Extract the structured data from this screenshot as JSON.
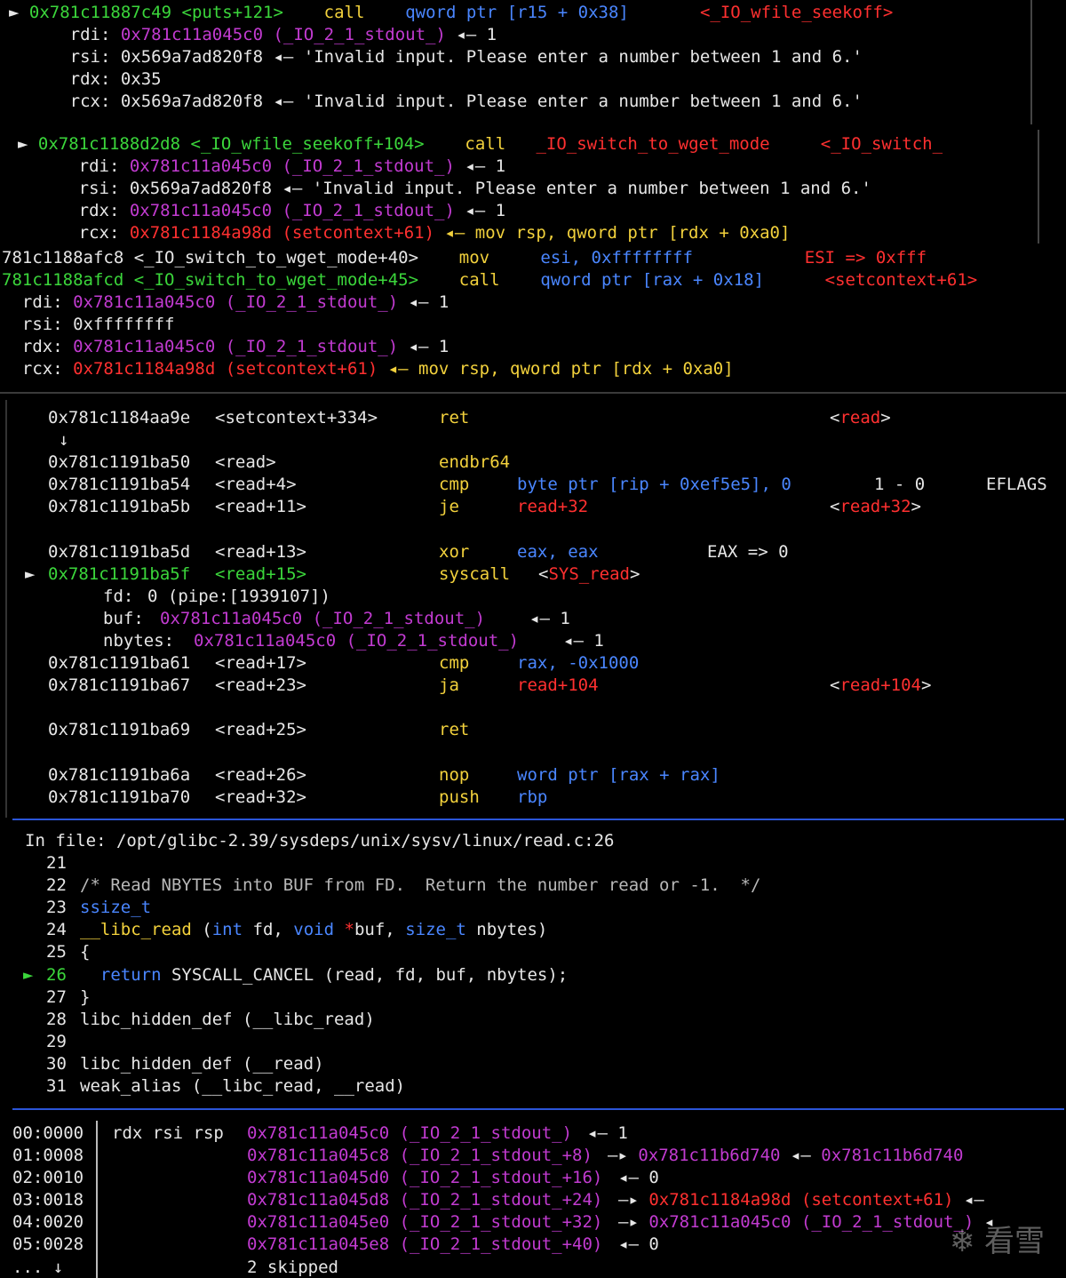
{
  "window1": {
    "lines": [
      {
        "arrow": "►",
        "addr": "0x781c11887c49",
        "sym": "<puts+121>",
        "mnem": "call",
        "op": "qword ptr [r15 + 0x38]",
        "target": "<_IO_wfile_seekoff>"
      },
      {
        "reg": "rdi:",
        "val": "0x781c11a045c0 (_IO_2_1_stdout_)",
        "tail": "◂— 1"
      },
      {
        "reg": "rsi:",
        "val": "0x569a7ad820f8",
        "tail": "◂— 'Invalid input. Please enter a number between 1 and 6.'"
      },
      {
        "reg": "rdx:",
        "val": "0x35",
        "tail": ""
      },
      {
        "reg": "rcx:",
        "val": "0x569a7ad820f8",
        "tail": "◂— 'Invalid input. Please enter a number between 1 and 6.'"
      }
    ]
  },
  "window2": {
    "lines": [
      {
        "arrow": "►",
        "addr": "0x781c1188d2d8",
        "sym": "<_IO_wfile_seekoff+104>",
        "mnem": "call",
        "op": "_IO_switch_to_wget_mode",
        "target": "<_IO_switch_"
      },
      {
        "reg": "rdi:",
        "val": "0x781c11a045c0 (_IO_2_1_stdout_)",
        "tail": "◂— 1"
      },
      {
        "reg": "rsi:",
        "val": "0x569a7ad820f8",
        "tail": "◂— 'Invalid input. Please enter a number between 1 and 6.'"
      },
      {
        "reg": "rdx:",
        "val": "0x781c11a045c0 (_IO_2_1_stdout_)",
        "tail": "◂— 1"
      },
      {
        "reg": "rcx:",
        "val": "0x781c1184a98d (setcontext+61)",
        "tail": "◂— mov rsp, qword ptr [rdx + 0xa0]"
      }
    ]
  },
  "window3": {
    "lines": [
      {
        "addr": "781c1188afc8",
        "sym": "<_IO_switch_to_wget_mode+40>",
        "mnem": "mov",
        "op": "esi, 0xffffffff",
        "note": "ESI => 0xfff"
      },
      {
        "addr": "781c1188afcd",
        "sym": "<_IO_switch_to_wget_mode+45>",
        "mnem": "call",
        "op": "qword ptr [rax + 0x18]",
        "target": "<setcontext+61>"
      },
      {
        "reg": "rdi:",
        "val": "0x781c11a045c0 (_IO_2_1_stdout_)",
        "tail": "◂— 1"
      },
      {
        "reg": "rsi:",
        "val": "0xffffffff",
        "tail": ""
      },
      {
        "reg": "rdx:",
        "val": "0x781c11a045c0 (_IO_2_1_stdout_)",
        "tail": "◂— 1"
      },
      {
        "reg": "rcx:",
        "val": "0x781c1184a98d (setcontext+61)",
        "tail": "◂— mov rsp, qword ptr [rdx + 0xa0]"
      }
    ]
  },
  "disasm": {
    "rows": [
      {
        "addr": "0x781c1184aa9e",
        "sym": "<setcontext+334>",
        "mnem": "ret",
        "op": "",
        "right": "<read>"
      },
      {
        "down": "↓"
      },
      {
        "addr": "0x781c1191ba50",
        "sym": "<read>",
        "mnem": "endbr64",
        "op": ""
      },
      {
        "addr": "0x781c1191ba54",
        "sym": "<read+4>",
        "mnem": "cmp",
        "op": "byte ptr [rip + 0xef5e5], 0",
        "mid": "1 - 0",
        "right": "EFLAGS"
      },
      {
        "addr": "0x781c1191ba5b",
        "sym": "<read+11>",
        "mnem": "je",
        "op": "read+32",
        "right": "<read+32>"
      },
      {
        "blank": ""
      },
      {
        "addr": "0x781c1191ba5d",
        "sym": "<read+13>",
        "mnem": "xor",
        "op": "eax, eax",
        "mid": "EAX => 0"
      },
      {
        "arrow": "►",
        "addr": "0x781c1191ba5f",
        "sym": "<read+15>",
        "mnem": "syscall",
        "op": "<SYS_read>"
      },
      {
        "argk": "fd:",
        "argv": "0 (pipe:[1939107])"
      },
      {
        "argk": "buf:",
        "argv": "0x781c11a045c0 (_IO_2_1_stdout_)",
        "tail": "◂— 1"
      },
      {
        "argk": "nbytes:",
        "argv": "0x781c11a045c0 (_IO_2_1_stdout_)",
        "tail": "◂— 1"
      },
      {
        "addr": "0x781c1191ba61",
        "sym": "<read+17>",
        "mnem": "cmp",
        "op": "rax, -0x1000"
      },
      {
        "addr": "0x781c1191ba67",
        "sym": "<read+23>",
        "mnem": "ja",
        "op": "read+104",
        "right": "<read+104>"
      },
      {
        "blank": ""
      },
      {
        "addr": "0x781c1191ba69",
        "sym": "<read+25>",
        "mnem": "ret",
        "op": ""
      },
      {
        "blank": ""
      },
      {
        "addr": "0x781c1191ba6a",
        "sym": "<read+26>",
        "mnem": "nop",
        "op": "word ptr [rax + rax]"
      },
      {
        "addr": "0x781c1191ba70",
        "sym": "<read+32>",
        "mnem": "push",
        "op": "rbp"
      }
    ]
  },
  "source": {
    "header": "In file: /opt/glibc-2.39/sysdeps/unix/sysv/linux/read.c:26",
    "lines": [
      {
        "n": "21",
        "code": ""
      },
      {
        "n": "22",
        "code": "/* Read NBYTES into BUF from FD.  Return the number read or -1.  */"
      },
      {
        "n": "23",
        "code": "ssize_t"
      },
      {
        "n": "24",
        "code": "__libc_read (int fd, void *buf, size_t nbytes)"
      },
      {
        "n": "25",
        "code": "{"
      },
      {
        "n": "26",
        "code": "  return SYSCALL_CANCEL (read, fd, buf, nbytes);",
        "current": true
      },
      {
        "n": "27",
        "code": "}"
      },
      {
        "n": "28",
        "code": "libc_hidden_def (__libc_read)"
      },
      {
        "n": "29",
        "code": ""
      },
      {
        "n": "30",
        "code": "libc_hidden_def (__read)"
      },
      {
        "n": "31",
        "code": "weak_alias (__libc_read, __read)"
      }
    ]
  },
  "stack": {
    "rows": [
      {
        "idx": "00:0000",
        "regs": "rdx rsi rsp",
        "addr": "0x781c11a045c0 (_IO_2_1_stdout_)",
        "chain": "◂— 1"
      },
      {
        "idx": "01:0008",
        "regs": "",
        "addr": "0x781c11a045c8 (_IO_2_1_stdout_+8)",
        "chain": "—▸ 0x781c11b6d740 ◂— 0x781c11b6d740"
      },
      {
        "idx": "02:0010",
        "regs": "",
        "addr": "0x781c11a045d0 (_IO_2_1_stdout_+16)",
        "chain": "◂— 0"
      },
      {
        "idx": "03:0018",
        "regs": "",
        "addr": "0x781c11a045d8 (_IO_2_1_stdout_+24)",
        "chain": "—▸ 0x781c1184a98d (setcontext+61) ◂—"
      },
      {
        "idx": "04:0020",
        "regs": "",
        "addr": "0x781c11a045e0 (_IO_2_1_stdout_+32)",
        "chain": "—▸ 0x781c11a045c0 (_IO_2_1_stdout_) ◂"
      },
      {
        "idx": "05:0028",
        "regs": "",
        "addr": "0x781c11a045e8 (_IO_2_1_stdout_+40)",
        "chain": "◂— 0"
      },
      {
        "idx": "... ↓",
        "regs": "",
        "addr": "2 skipped",
        "chain": ""
      }
    ]
  },
  "watermark": "看雪"
}
